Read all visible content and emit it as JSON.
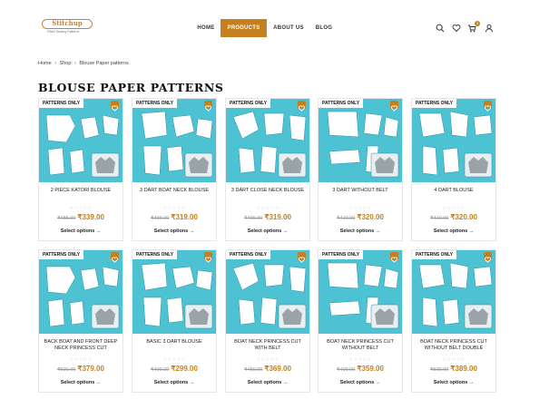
{
  "header": {
    "logo_text": "Stitchup",
    "logo_tagline": "Fitted Sewing Patterns",
    "nav": [
      "HOME",
      "PRODUCTS",
      "ABOUT US",
      "BLOG"
    ],
    "cart_count": "0",
    "icons": [
      "search-icon",
      "heart-icon",
      "cart-icon",
      "user-icon"
    ],
    "accent_color": "#c48020"
  },
  "breadcrumb": [
    "Home",
    "Shop",
    "Blouse Paper patterns"
  ],
  "page_title": "BLOUSE PAPER PATTERNS",
  "products": [
    {
      "tag": "PATTERNS ONLY",
      "title": "2 PIECE KATORI BLOUSE",
      "old_price": "₹485.00",
      "price": "₹339.00",
      "cta": "Select options →"
    },
    {
      "tag": "PATTERNS ONLY",
      "title": "3 DART BOAT NECK BLOUSE",
      "old_price": "₹499.00",
      "price": "₹319.00",
      "cta": "Select options →"
    },
    {
      "tag": "PATTERNS ONLY",
      "title": "3 DART CLOSE NECK BLOUSE",
      "old_price": "₹499.00",
      "price": "₹319.00",
      "cta": "Select options →"
    },
    {
      "tag": "PATTERNS ONLY",
      "title": "3 DART WITHOUT BELT",
      "old_price": "₹410.00",
      "price": "₹320.00",
      "cta": "Select options →"
    },
    {
      "tag": "PATTERNS ONLY",
      "title": "4 DART BLOUSE",
      "old_price": "₹410.00",
      "price": "₹320.00",
      "cta": "Select options →"
    },
    {
      "tag": "PATTERNS ONLY",
      "title": "BACK BOAT AND FRONT DEEP NECK PRINCESS CUT",
      "old_price": "₹600.00",
      "price": "₹379.00",
      "cta": "Select options →"
    },
    {
      "tag": "PATTERNS ONLY",
      "title": "BASIC 3 DART BLOUSE",
      "old_price": "₹400.00",
      "price": "₹299.00",
      "cta": "Select options →"
    },
    {
      "tag": "PATTERNS ONLY",
      "title": "BOAT NECK PRINCESS CUT WITH BELT",
      "old_price": "₹450.00",
      "price": "₹369.00",
      "cta": "Select options →"
    },
    {
      "tag": "PATTERNS ONLY",
      "title": "BOAT NECK PRINCESS CUT WITHOUT BELT",
      "old_price": "₹400.00",
      "price": "₹359.00",
      "cta": "Select options →"
    },
    {
      "tag": "PATTERNS ONLY",
      "title": "BOAT NECK PRINCESS CUT WITHOUT BELT DOUBLE",
      "old_price": "₹500.00",
      "price": "₹389.00",
      "cta": "Select options →"
    }
  ]
}
